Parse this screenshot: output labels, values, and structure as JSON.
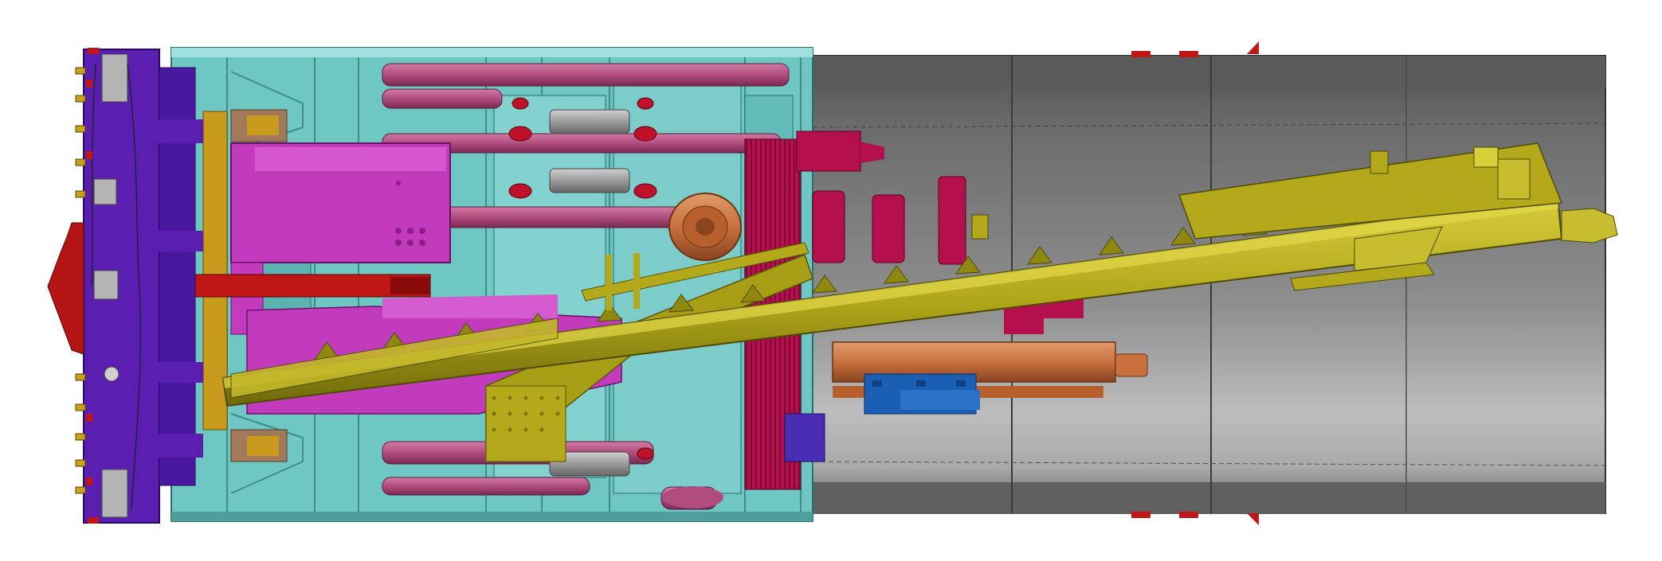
{
  "drawing": {
    "kind": "tunnel-boring-machine-cad-section",
    "labels": []
  },
  "palette": {
    "background": "#ffffff",
    "cutterhead": "#5a1fb0",
    "cutterhead_dark": "#3e1287",
    "shield_cyan": "#6fc7c4",
    "shield_cyan_dark": "#3f8d8a",
    "shield_cyan_light": "#9ee0dd",
    "thrust_pink": "#b04d7e",
    "thrust_pink_dark": "#7a2950",
    "magenta": "#c23bbd",
    "magenta_dark": "#8a1f86",
    "screw_olive": "#b3a91a",
    "screw_olive_dark": "#6f6a0a",
    "screw_olive_light": "#d9cf3a",
    "segment_grey": "#8a8a8a",
    "segment_grey_dark": "#555555",
    "segment_grey_light": "#b8b8b8",
    "crimson": "#b5104e",
    "red": "#c01616",
    "copper": "#c8713f",
    "blue": "#1b5fb5",
    "steel": "#9a9a9a",
    "gold": "#c89a1d"
  },
  "components": [
    {
      "name": "cutterhead-icon"
    },
    {
      "name": "front-shield-icon"
    },
    {
      "name": "thrust-cylinders-icon"
    },
    {
      "name": "screw-conveyor-icon"
    },
    {
      "name": "erector-motor-icon"
    },
    {
      "name": "segment-lining-icon"
    },
    {
      "name": "hydraulic-unit-icon"
    },
    {
      "name": "main-drive-motor-icon"
    }
  ]
}
